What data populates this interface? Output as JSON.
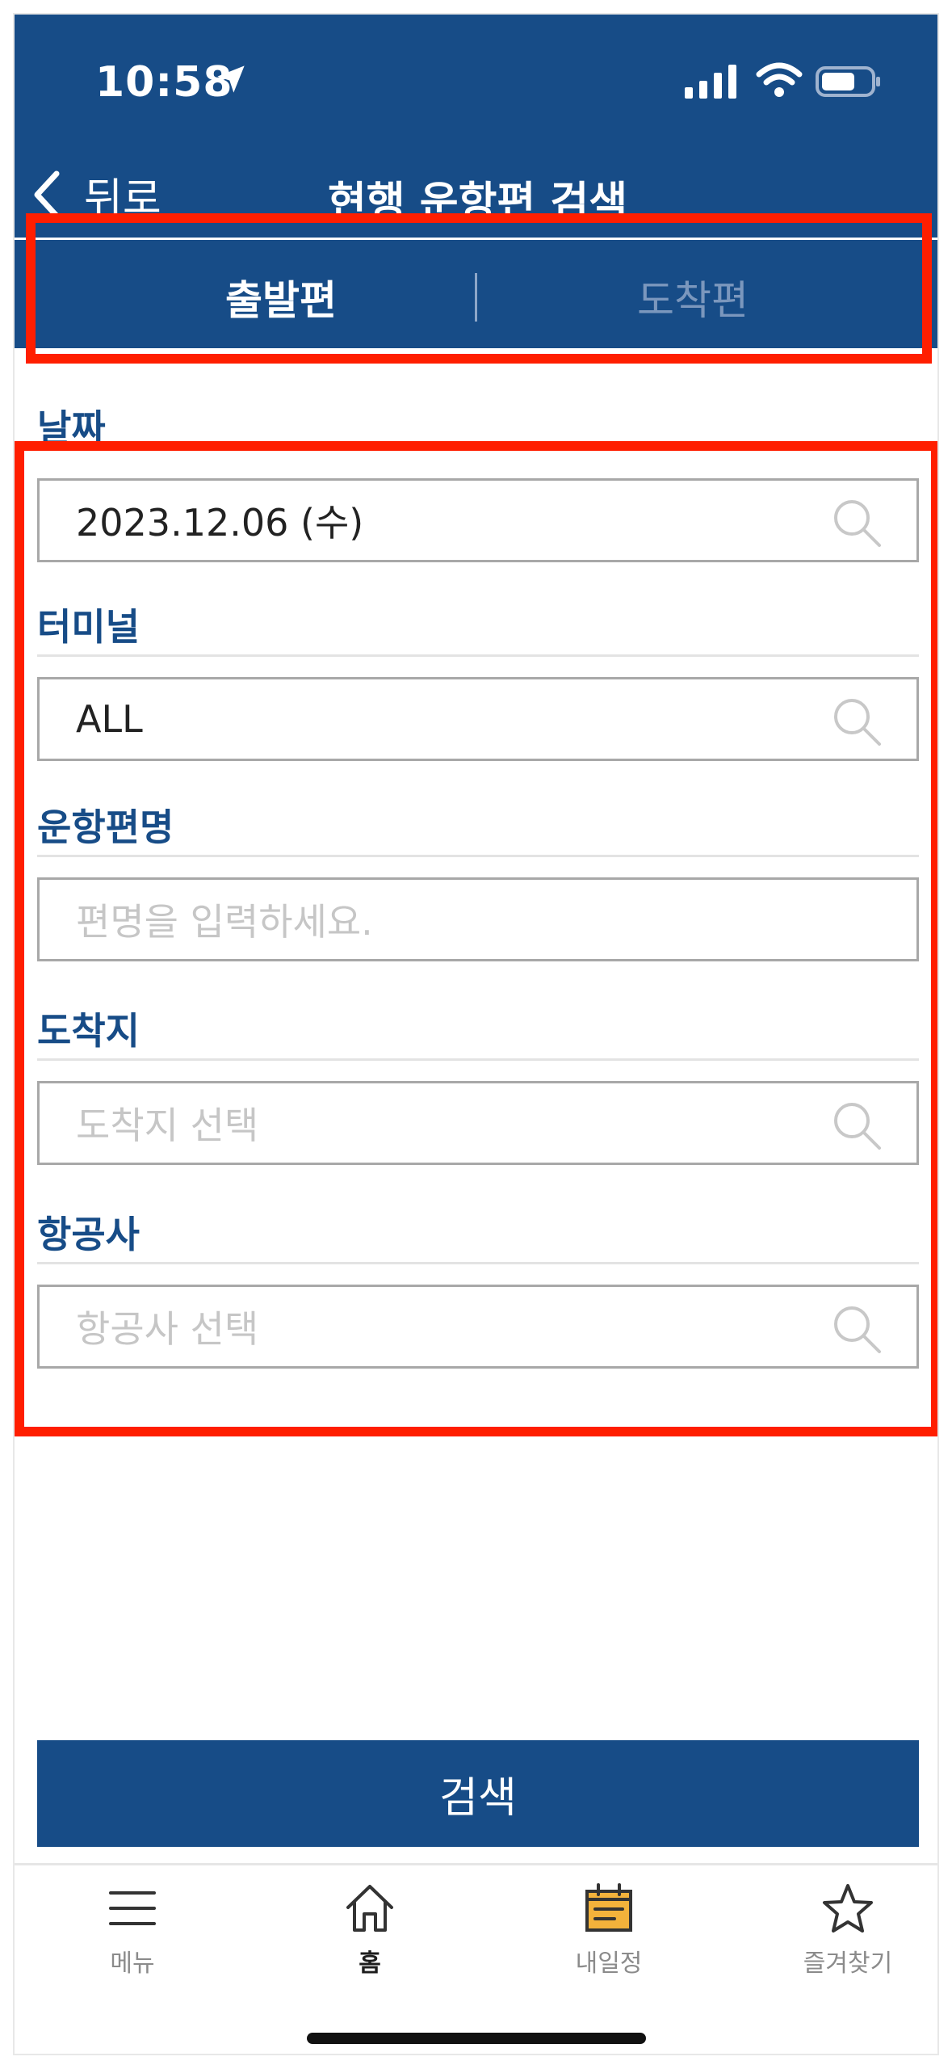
{
  "status_bar": {
    "time": "10:58"
  },
  "nav_header": {
    "back_label": "뒤로",
    "title": "현행 운항편 검색"
  },
  "tabs": [
    {
      "label": "출발편",
      "selected": true
    },
    {
      "label": "도착편",
      "selected": false
    }
  ],
  "form": {
    "date": {
      "label": "날짜",
      "value": "2023.12.06 (수)"
    },
    "terminal": {
      "label": "터미널",
      "value": "ALL"
    },
    "flight_no": {
      "label": "운항편명",
      "placeholder": "편명을 입력하세요."
    },
    "destination": {
      "label": "도착지",
      "placeholder": "도착지 선택"
    },
    "airline": {
      "label": "항공사",
      "placeholder": "항공사 선택"
    }
  },
  "search_button": {
    "label": "검색"
  },
  "bottom_nav": [
    {
      "label": "메뉴",
      "icon": "menu-icon",
      "active": false
    },
    {
      "label": "홈",
      "icon": "home-icon",
      "active": true
    },
    {
      "label": "내일정",
      "icon": "calendar-icon",
      "active": false
    },
    {
      "label": "즐겨찾기",
      "icon": "star-icon",
      "active": false
    }
  ],
  "colors": {
    "brand": "#174c87",
    "highlight": "#ff1e00",
    "calendar_accent": "#f3b23b"
  }
}
